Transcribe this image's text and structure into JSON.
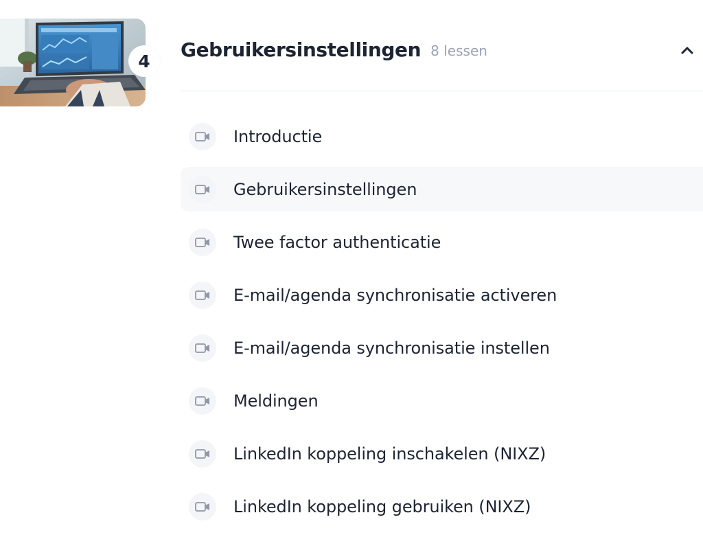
{
  "module": {
    "number": "4",
    "title": "Gebruikersinstellingen",
    "lesson_count": "8 lessen",
    "thumbnail_icon": "laptop-dashboard-photo",
    "collapse_icon": "chevron-up-icon"
  },
  "lessons": [
    {
      "label": "Introductie",
      "icon": "video-camera-icon",
      "active": false
    },
    {
      "label": "Gebruikersinstellingen",
      "icon": "video-camera-icon",
      "active": true
    },
    {
      "label": "Twee factor authenticatie",
      "icon": "video-camera-icon",
      "active": false
    },
    {
      "label": "E-mail/agenda synchronisatie activeren",
      "icon": "video-camera-icon",
      "active": false
    },
    {
      "label": "E-mail/agenda synchronisatie instellen",
      "icon": "video-camera-icon",
      "active": false
    },
    {
      "label": "Meldingen",
      "icon": "video-camera-icon",
      "active": false
    },
    {
      "label": "LinkedIn koppeling inschakelen (NIXZ)",
      "icon": "video-camera-icon",
      "active": false
    },
    {
      "label": "LinkedIn koppeling gebruiken (NIXZ)",
      "icon": "video-camera-icon",
      "active": false
    }
  ],
  "colors": {
    "text": "#1d2433",
    "muted": "#9aa3b5",
    "icon": "#8f97a8",
    "active_row": "#f7f8fa"
  }
}
